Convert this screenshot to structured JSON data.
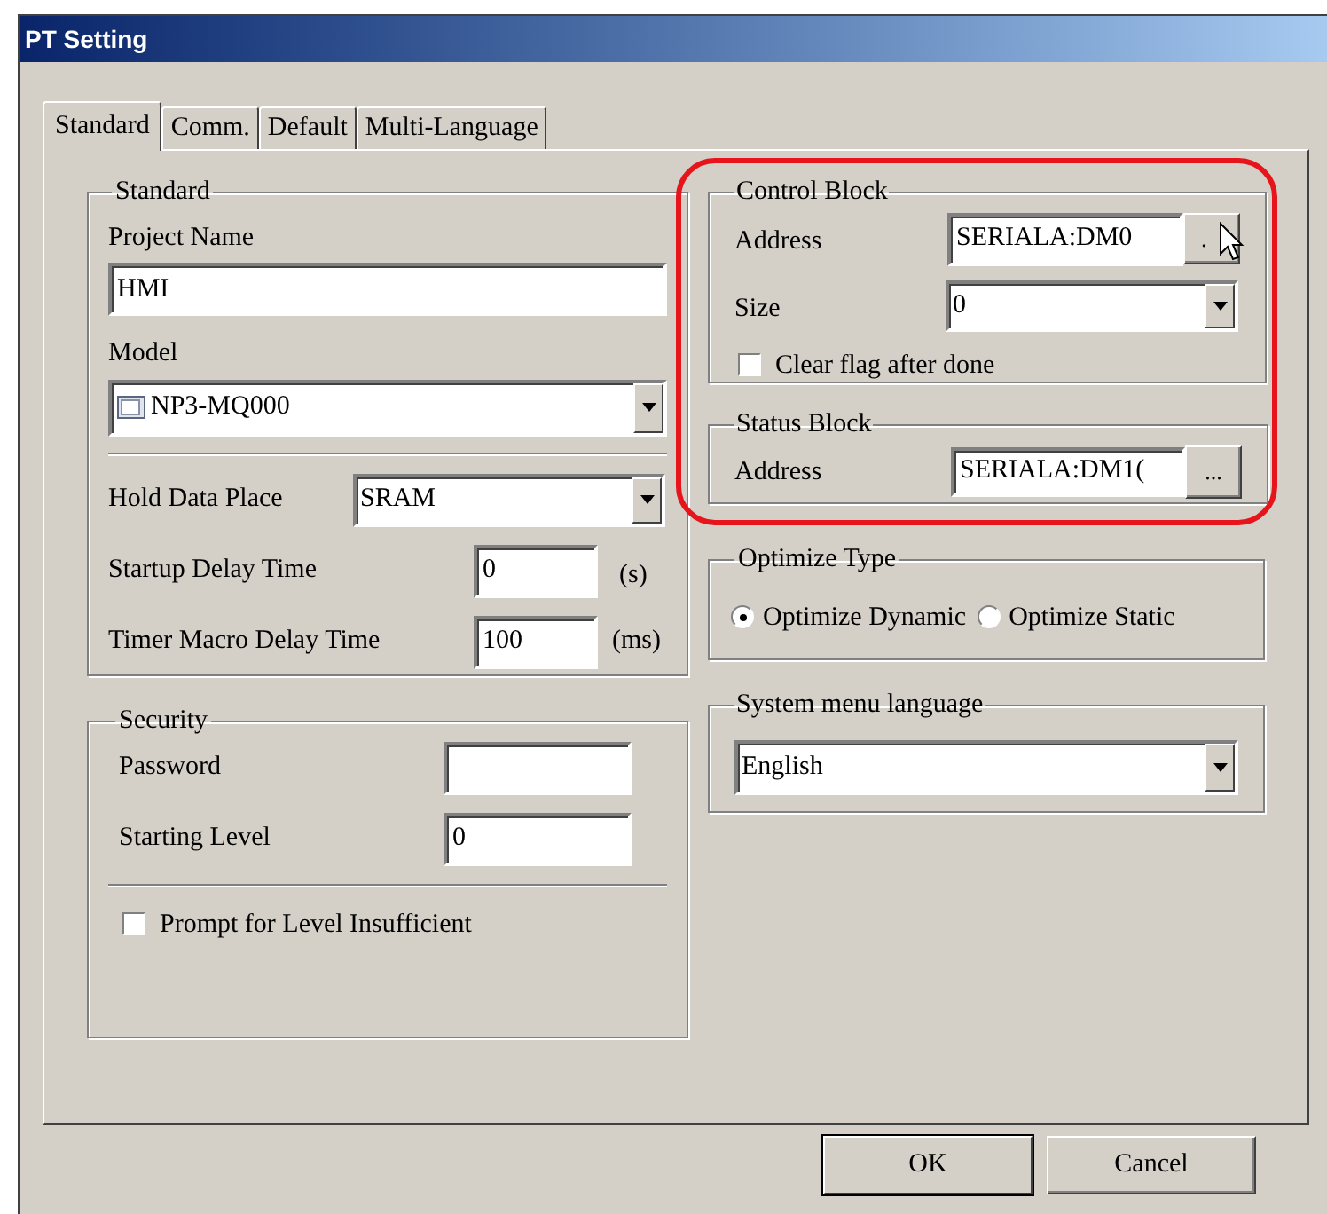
{
  "window": {
    "title": "PT Setting"
  },
  "tabs": [
    {
      "label": "Standard",
      "selected": true
    },
    {
      "label": "Comm.",
      "selected": false
    },
    {
      "label": "Default",
      "selected": false
    },
    {
      "label": "Multi-Language",
      "selected": false
    }
  ],
  "standard": {
    "title": "Standard",
    "project_name": {
      "label": "Project Name",
      "value": "HMI"
    },
    "model": {
      "label": "Model",
      "value": "NP3-MQ000"
    },
    "hold_data_place": {
      "label": "Hold Data Place",
      "value": "SRAM"
    },
    "startup_delay_time": {
      "label": "Startup Delay Time",
      "value": "0",
      "unit": "(s)"
    },
    "timer_macro_delay_time": {
      "label": "Timer Macro Delay Time",
      "value": "100",
      "unit": "(ms)"
    }
  },
  "security": {
    "title": "Security",
    "password": {
      "label": "Password"
    },
    "starting_level": {
      "label": "Starting Level",
      "value": "0"
    },
    "prompt_for_level_insufficient": {
      "label": "Prompt for Level Insufficient",
      "checked": false
    }
  },
  "control_block": {
    "title": "Control Block",
    "address": {
      "label": "Address",
      "value": "SERIALA:DM0",
      "button": "."
    },
    "size": {
      "label": "Size",
      "value": "0"
    },
    "clear_flag_after_done": {
      "label": "Clear flag after done",
      "checked": false
    }
  },
  "status_block": {
    "title": "Status Block",
    "address": {
      "label": "Address",
      "value": "SERIALA:DM1(",
      "button": "..."
    }
  },
  "optimize_type": {
    "title": "Optimize Type",
    "options": [
      {
        "label": "Optimize Dynamic",
        "selected": true
      },
      {
        "label": "Optimize Static",
        "selected": false
      }
    ]
  },
  "system_menu_language": {
    "title": "System menu language",
    "value": "English"
  },
  "buttons": [
    "OK",
    "Cancel"
  ]
}
